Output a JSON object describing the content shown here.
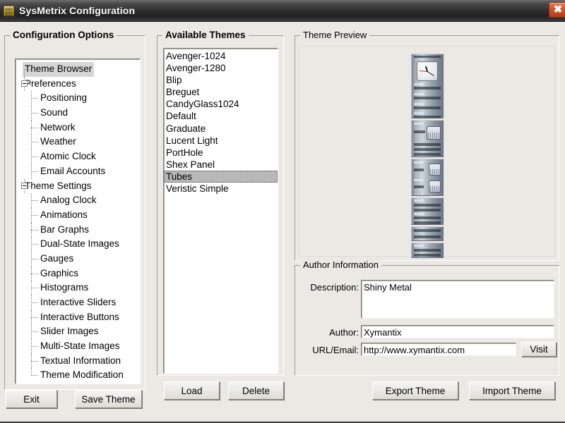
{
  "window": {
    "title": "SysMetrix Configuration",
    "icon": "meter-icon",
    "close_label": "✖"
  },
  "config_options": {
    "legend": "Configuration Options",
    "tree": [
      {
        "label": "Theme Browser",
        "level": 0,
        "selected": true,
        "expander": false
      },
      {
        "label": "Preferences",
        "level": 0,
        "selected": false,
        "expander": true
      },
      {
        "label": "Positioning",
        "level": 1,
        "selected": false,
        "expander": false
      },
      {
        "label": "Sound",
        "level": 1,
        "selected": false,
        "expander": false
      },
      {
        "label": "Network",
        "level": 1,
        "selected": false,
        "expander": false
      },
      {
        "label": "Weather",
        "level": 1,
        "selected": false,
        "expander": false
      },
      {
        "label": "Atomic Clock",
        "level": 1,
        "selected": false,
        "expander": false
      },
      {
        "label": "Email Accounts",
        "level": 1,
        "selected": false,
        "expander": false
      },
      {
        "label": "Theme Settings",
        "level": 0,
        "selected": false,
        "expander": true
      },
      {
        "label": "Analog Clock",
        "level": 1,
        "selected": false,
        "expander": false
      },
      {
        "label": "Animations",
        "level": 1,
        "selected": false,
        "expander": false
      },
      {
        "label": "Bar Graphs",
        "level": 1,
        "selected": false,
        "expander": false
      },
      {
        "label": "Dual-State Images",
        "level": 1,
        "selected": false,
        "expander": false
      },
      {
        "label": "Gauges",
        "level": 1,
        "selected": false,
        "expander": false
      },
      {
        "label": "Graphics",
        "level": 1,
        "selected": false,
        "expander": false
      },
      {
        "label": "Histograms",
        "level": 1,
        "selected": false,
        "expander": false
      },
      {
        "label": "Interactive Sliders",
        "level": 1,
        "selected": false,
        "expander": false
      },
      {
        "label": "Interactive Buttons",
        "level": 1,
        "selected": false,
        "expander": false
      },
      {
        "label": "Slider Images",
        "level": 1,
        "selected": false,
        "expander": false
      },
      {
        "label": "Multi-State Images",
        "level": 1,
        "selected": false,
        "expander": false
      },
      {
        "label": "Textual Information",
        "level": 1,
        "selected": false,
        "expander": false
      },
      {
        "label": "Theme Modification",
        "level": 1,
        "selected": false,
        "expander": false
      }
    ]
  },
  "available_themes": {
    "legend": "Available Themes",
    "items": [
      {
        "label": "Avenger-1024",
        "selected": false
      },
      {
        "label": "Avenger-1280",
        "selected": false
      },
      {
        "label": "Blip",
        "selected": false
      },
      {
        "label": "Breguet",
        "selected": false
      },
      {
        "label": "CandyGlass1024",
        "selected": false
      },
      {
        "label": "Default",
        "selected": false
      },
      {
        "label": "Graduate",
        "selected": false
      },
      {
        "label": "Lucent Light",
        "selected": false
      },
      {
        "label": "PortHole",
        "selected": false
      },
      {
        "label": "Shex Panel",
        "selected": false
      },
      {
        "label": "Tubes",
        "selected": true
      },
      {
        "label": "Veristic Simple",
        "selected": false
      }
    ]
  },
  "theme_preview": {
    "legend": "Theme Preview",
    "skin_name": "metallic-sidebar-skin"
  },
  "author_information": {
    "legend": "Author Information",
    "description_label": "Description:",
    "description_value": "Shiny Metal",
    "author_label": "Author:",
    "author_value": "Xymantix",
    "url_label": "URL/Email:",
    "url_value": "http://www.xymantix.com",
    "visit_label": "Visit"
  },
  "buttons": {
    "exit": "Exit",
    "save_theme": "Save Theme",
    "load": "Load",
    "delete": "Delete",
    "export_theme": "Export Theme",
    "import_theme": "Import Theme"
  },
  "colors": {
    "window_face": "#ece9e4",
    "titlebar_dark": "#2e2e2e",
    "close_red": "#d4522c",
    "list_selection": "#b8b8b8",
    "tree_selection": "#d6d6d6"
  }
}
